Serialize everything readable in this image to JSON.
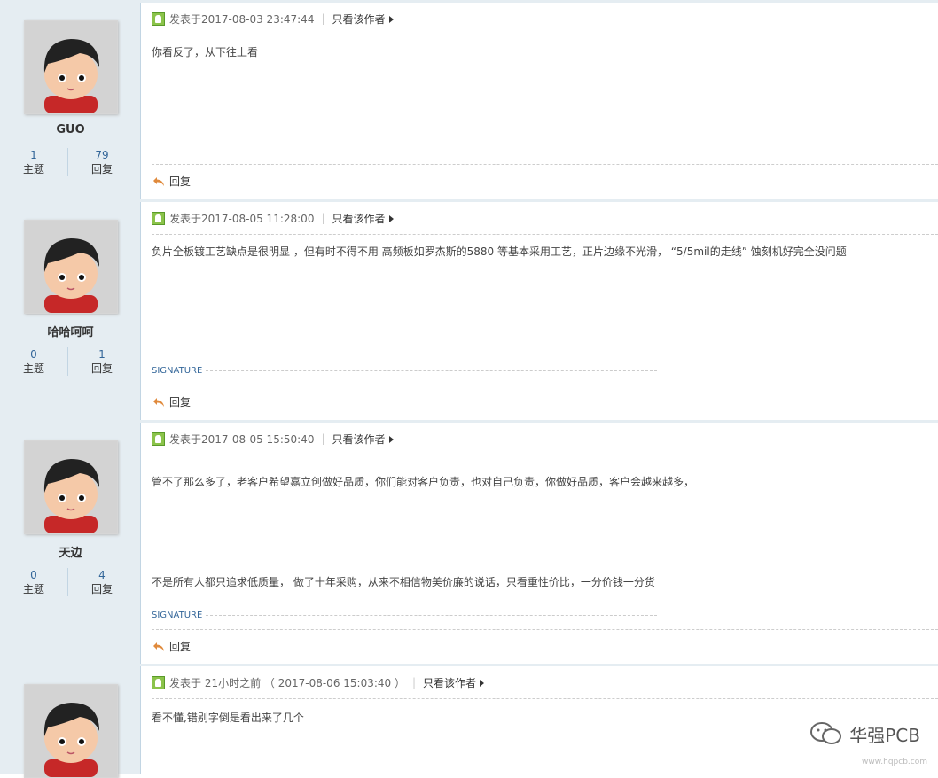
{
  "labels": {
    "topics": "主题",
    "replies": "回复",
    "only_author": "只看该作者",
    "reply_button": "回复",
    "signature": "SIGNATURE"
  },
  "posts": [
    {
      "username": "GUO",
      "topics_count": "1",
      "replies_count": "79",
      "posted": "发表于2017-08-03 23:47:44",
      "content": [
        "你看反了，从下往上看"
      ]
    },
    {
      "username": "哈哈呵呵",
      "topics_count": "0",
      "replies_count": "1",
      "posted": "发表于2017-08-05 11:28:00",
      "content": [
        "负片全板镀工艺缺点是很明显 ，但有时不得不用  高频板如罗杰斯的5880 等基本采用工艺，正片边缘不光滑，  “5/5mil的走线” 蚀刻机好完全没问题"
      ]
    },
    {
      "username": "天边",
      "topics_count": "0",
      "replies_count": "4",
      "posted": "发表于2017-08-05 15:50:40",
      "content": [
        "管不了那么多了，老客户希望嘉立创做好品质，你们能对客户负责，也对自己负责，你做好品质，客户会越来越多，",
        "不是所有人都只追求低质量，  做了十年采购，从来不相信物美价廉的说话，只看重性价比，一分价钱一分货"
      ]
    },
    {
      "username": "",
      "posted": "发表于 21小时之前 （ 2017-08-06 15:03:40 ）",
      "content": [
        "看不懂,错别字倒是看出来了几个"
      ]
    }
  ],
  "watermark": {
    "main": "华强PCB",
    "sub": "www.hqpcb.com"
  }
}
